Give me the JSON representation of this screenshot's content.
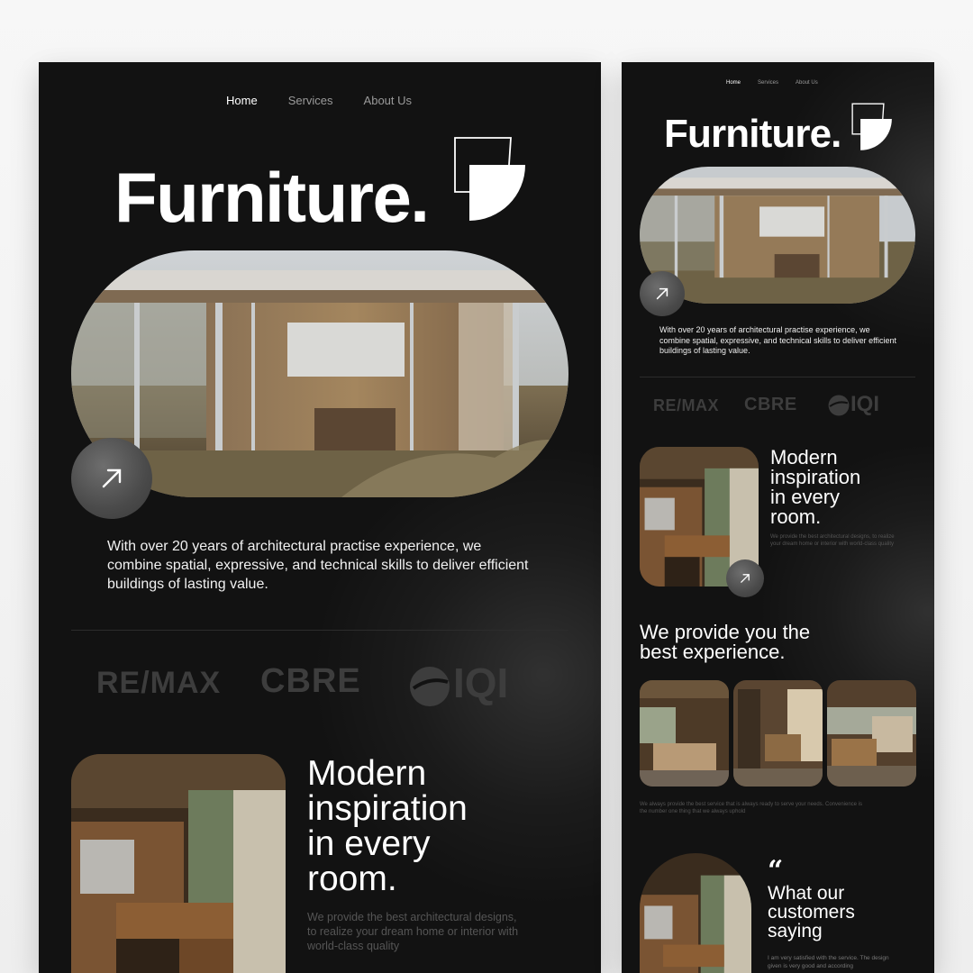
{
  "colors": {
    "page_bg": "#f2f2f2",
    "panel_bg": "#121212",
    "text_primary": "#ffffff",
    "text_muted": "#555555",
    "partner_logo": "#3d3d3d",
    "button_bg": "#555555"
  },
  "desktop": {
    "nav": {
      "home": "Home",
      "services": "Services",
      "about": "About Us"
    },
    "brand": "Furniture.",
    "hero_paragraph": "With over 20 years of architectural practise experience, we combine spatial, expressive, and technical skills to deliver efficient buildings of lasting value.",
    "partners": [
      "RE/MAX",
      "CBRE",
      "IQI"
    ],
    "section_heading": [
      "Modern",
      "inspiration",
      "in every",
      "room."
    ],
    "section_text": "We provide the best architectural designs, to realize your dream home or interior with world-class quality"
  },
  "mobile": {
    "nav": {
      "home": "Home",
      "services": "Services",
      "about": "About Us"
    },
    "brand": "Furniture.",
    "hero_paragraph": "With over 20 years of architectural practise experience, we combine spatial, expressive, and technical skills to deliver efficient buildings of lasting value.",
    "partners": [
      "RE/MAX",
      "CBRE",
      "IQI"
    ],
    "section_heading": [
      "Modern",
      "inspiration",
      "in every",
      "room."
    ],
    "section_text": "We provide the best architectural designs, to realize your dream home or interior with world-class quality",
    "experience_heading": [
      "We provide you the",
      "best experience."
    ],
    "experience_text": "We always provide the best service that is always ready to serve your needs. Convenience is the number one thing that we always uphold",
    "quote_mark": "“",
    "testimonial_heading": [
      "What our",
      "customers",
      "saying"
    ],
    "testimonial_text": "I am very satisfied with the service. The design given is very good and according"
  },
  "icons": {
    "arrow": "arrow-up-right-icon",
    "logo": "brand-mark-icon"
  }
}
